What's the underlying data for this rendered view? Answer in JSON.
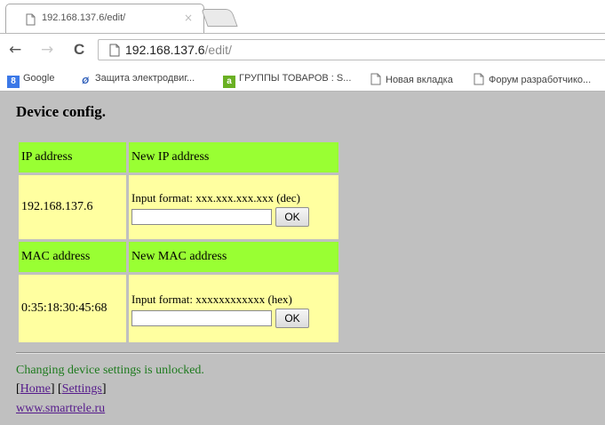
{
  "browser": {
    "tab_title": "192.168.137.6/edit/",
    "tab_close": "×",
    "url_host": "192.168.137.6",
    "url_path": "/edit/",
    "back_glyph": "←",
    "forward_glyph": "→",
    "reload_glyph": "C",
    "bookmarks": [
      {
        "icon": "google-icon",
        "label": "Google"
      },
      {
        "icon": "motor-icon",
        "label": "Защита электродвиг..."
      },
      {
        "icon": "catalog-icon",
        "label": "ГРУППЫ ТОВАРОВ : S..."
      },
      {
        "icon": "page-icon",
        "label": "Новая вкладка"
      },
      {
        "icon": "page-icon",
        "label": "Форум разработчико..."
      }
    ]
  },
  "page": {
    "title": "Device config.",
    "ip": {
      "label": "IP address",
      "new_label": "New IP address",
      "value": "192.168.137.6",
      "format": "Input format: xxx.xxx.xxx.xxx (dec)",
      "input_value": "",
      "ok_label": "OK"
    },
    "mac": {
      "label": "MAC address",
      "new_label": "New MAC address",
      "value": "0:35:18:30:45:68",
      "format": "Input format: xxxxxxxxxxxx (hex)",
      "input_value": "",
      "ok_label": "OK"
    },
    "status": "Changing device settings is unlocked.",
    "links": {
      "open": "[",
      "home": "Home",
      "sep": "] [",
      "settings": "Settings",
      "close": "]"
    },
    "site": "www.smartrele.ru"
  },
  "colors": {
    "background": "#c0c0c0",
    "header_cell": "#99ff33",
    "value_cell": "#ffffa0",
    "status_text": "#1e7a1e",
    "link": "#551a8b"
  }
}
